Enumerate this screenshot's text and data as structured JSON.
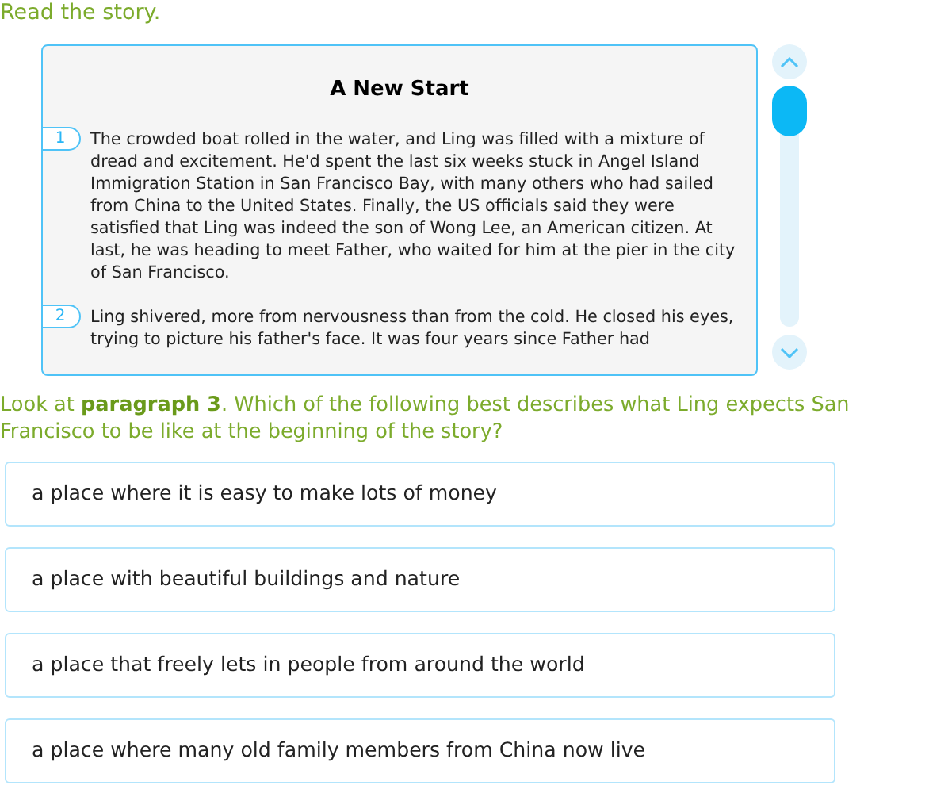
{
  "instruction": "Read the story.",
  "story": {
    "title": "A New Start",
    "paragraphs": [
      {
        "number": "1",
        "text": "The crowded boat rolled in the water, and Ling was filled with a mixture of dread and excitement. He'd spent the last six weeks stuck in Angel Island Immigration Station in San Francisco Bay, with many others who had sailed from China to the United States. Finally, the US officials said they were satisfied that Ling was indeed the son of Wong Lee, an American citizen. At last, he was heading to meet Father, who waited for him at the pier in the city of San Francisco."
      },
      {
        "number": "2",
        "text": "Ling shivered, more from nervousness than from the cold. He closed his eyes, trying to picture his father's face. It was four years since Father had"
      }
    ]
  },
  "question": "Look at **paragraph 3**. Which of the following best describes what Ling expects San Francisco to be like at the beginning of the story?",
  "choices": [
    {
      "text": "a place where it is easy to make lots of money",
      "selected": false
    },
    {
      "text": "a place with beautiful buildings and nature",
      "selected": false
    },
    {
      "text": "a place that freely lets in people from around the world",
      "selected": false
    },
    {
      "text": "a place where many old family members from China now live",
      "selected": false
    }
  ]
}
